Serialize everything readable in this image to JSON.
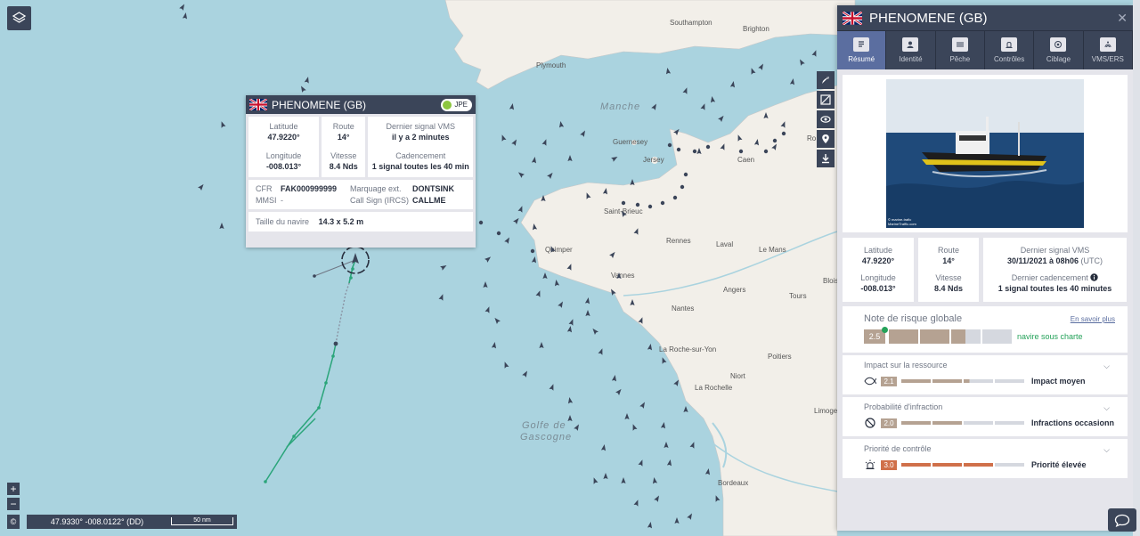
{
  "map": {
    "sea_labels": [
      "Manche",
      "Golfe de",
      "Gascogne"
    ],
    "places": [
      "Southampton",
      "Brighton",
      "Plymouth",
      "Guernesey",
      "Jersey",
      "Caen",
      "Ro",
      "Saint-Brieuc",
      "Rennes",
      "Laval",
      "Le Mans",
      "Quimper",
      "Vannes",
      "Angers",
      "Tours",
      "Blois",
      "Nantes",
      "La Roche-sur-Yon",
      "Poitiers",
      "Niort",
      "La Rochelle",
      "Limoge",
      "Bordeaux"
    ],
    "track_color": "#2aa57a"
  },
  "controls": {
    "zoom_in": "+",
    "zoom_out": "−",
    "copyright": "©",
    "coordinates": "47.9330° -008.0122° (DD)",
    "scale": "50 nm"
  },
  "map_tools": [
    "rocket-icon",
    "measure-icon",
    "eye-icon",
    "pin-icon",
    "download-icon"
  ],
  "popup": {
    "vessel_name": "PHENOMENE (GB)",
    "badge": "JPE",
    "latitude_label": "Latitude",
    "latitude": "47.9220°",
    "longitude_label": "Longitude",
    "longitude": "-008.013°",
    "route_label": "Route",
    "route": "14°",
    "speed_label": "Vitesse",
    "speed": "8.4 Nds",
    "signal_label": "Dernier signal VMS",
    "signal": "il y a 2 minutes",
    "cadence_label": "Cadencement",
    "cadence": "1 signal toutes les 40 min",
    "cfr_label": "CFR",
    "cfr": "FAK000999999",
    "marking_label": "Marquage ext.",
    "marking": "DONTSINK",
    "mmsi_label": "MMSI",
    "mmsi": "-",
    "callsign_label": "Call Sign (IRCS)",
    "callsign": "CALLME",
    "size_label": "Taille du navire",
    "size": "14.3 x 5.2 m"
  },
  "panel": {
    "vessel_name": "PHENOMENE (GB)",
    "close": "✕",
    "tabs": [
      {
        "label": "Résumé",
        "icon": "summary-icon"
      },
      {
        "label": "Identité",
        "icon": "identity-icon"
      },
      {
        "label": "Pêche",
        "icon": "fishing-icon"
      },
      {
        "label": "Contrôles",
        "icon": "controls-icon"
      },
      {
        "label": "Ciblage",
        "icon": "target-icon"
      },
      {
        "label": "VMS/ERS",
        "icon": "vms-icon"
      }
    ],
    "photo_caption_1": "© marine-trafic",
    "photo_caption_2": "MarineTraffic.com",
    "latitude_label": "Latitude",
    "latitude": "47.9220°",
    "longitude_label": "Longitude",
    "longitude": "-008.013°",
    "route_label": "Route",
    "route": "14°",
    "speed_label": "Vitesse",
    "speed": "8.4 Nds",
    "signal_label": "Dernier signal VMS",
    "signal": "30/11/2021 à 08h06",
    "signal_tz": "(UTC)",
    "cadence_label": "Dernier cadencement",
    "cadence": "1 signal toutes les 40 minutes",
    "risk": {
      "title": "Note de risque globale",
      "more": "En savoir plus",
      "score": "2.5",
      "status": "navire sous charte",
      "fill_fraction": 0.62,
      "color": "#b5a292"
    },
    "subscores": [
      {
        "title": "Impact sur la ressource",
        "score": "2.1",
        "label": "Impact moyen",
        "color": "#b5a292",
        "fill_fraction": 0.55,
        "icon": "fish-icon"
      },
      {
        "title": "Probabilité d'infraction",
        "score": "2.0",
        "label": "Infractions occasionnelles",
        "color": "#b5a292",
        "fill_fraction": 0.5,
        "icon": "forbidden-icon"
      },
      {
        "title": "Priorité de contrôle",
        "score": "3.0",
        "label": "Priorité élevée",
        "color": "#d0704a",
        "fill_fraction": 0.75,
        "icon": "alarm-icon"
      }
    ]
  }
}
